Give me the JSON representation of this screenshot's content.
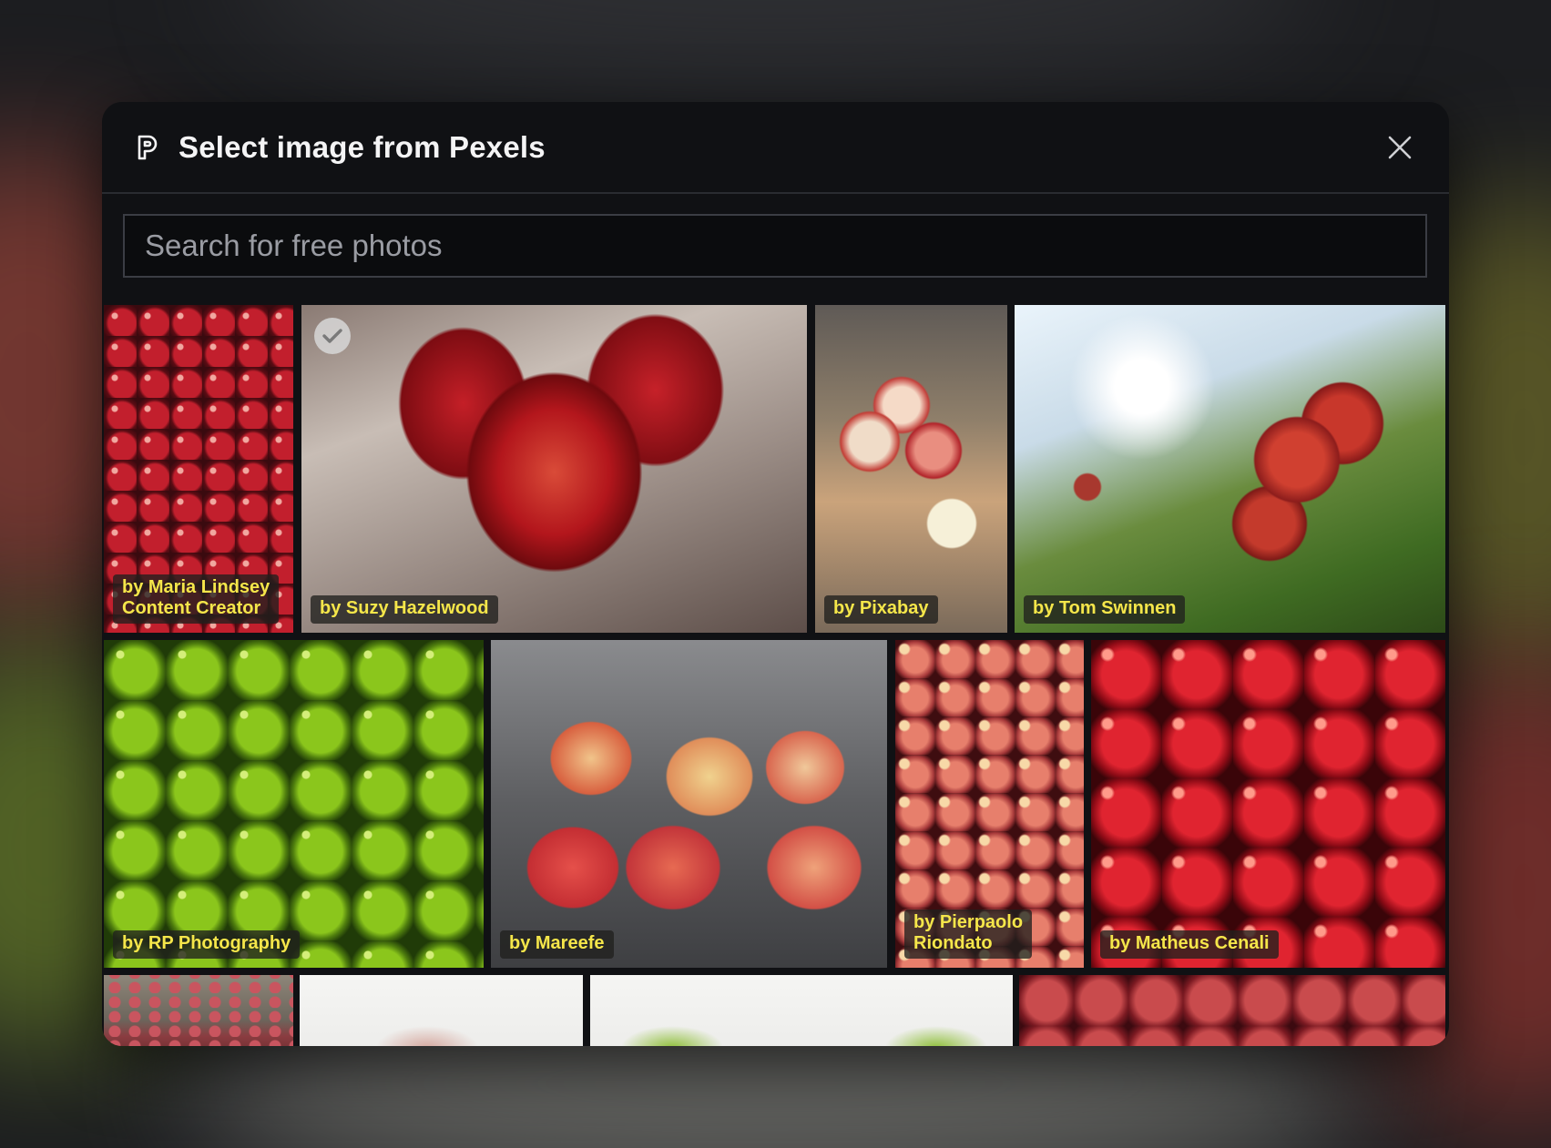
{
  "modal": {
    "title": "Select image from Pexels",
    "logo_icon": "pexels-logo-icon",
    "close_icon": "close-icon"
  },
  "search": {
    "placeholder": "Search for free photos",
    "value": ""
  },
  "photos": [
    {
      "credit": "by Maria Lindsey\nContent Creator",
      "selected": false
    },
    {
      "credit": "by Suzy Hazelwood",
      "selected": true
    },
    {
      "credit": "by Pixabay",
      "selected": false
    },
    {
      "credit": "by Tom Swinnen",
      "selected": false
    },
    {
      "credit": "by RP Photography",
      "selected": false
    },
    {
      "credit": "by Mareefe",
      "selected": false
    },
    {
      "credit": "by Pierpaolo\nRiondato",
      "selected": false
    },
    {
      "credit": "by Matheus Cenali",
      "selected": false
    }
  ],
  "colors": {
    "credit_text": "#f5e64a",
    "modal_bg": "#101114",
    "checkmark": "#7a7a7a"
  }
}
